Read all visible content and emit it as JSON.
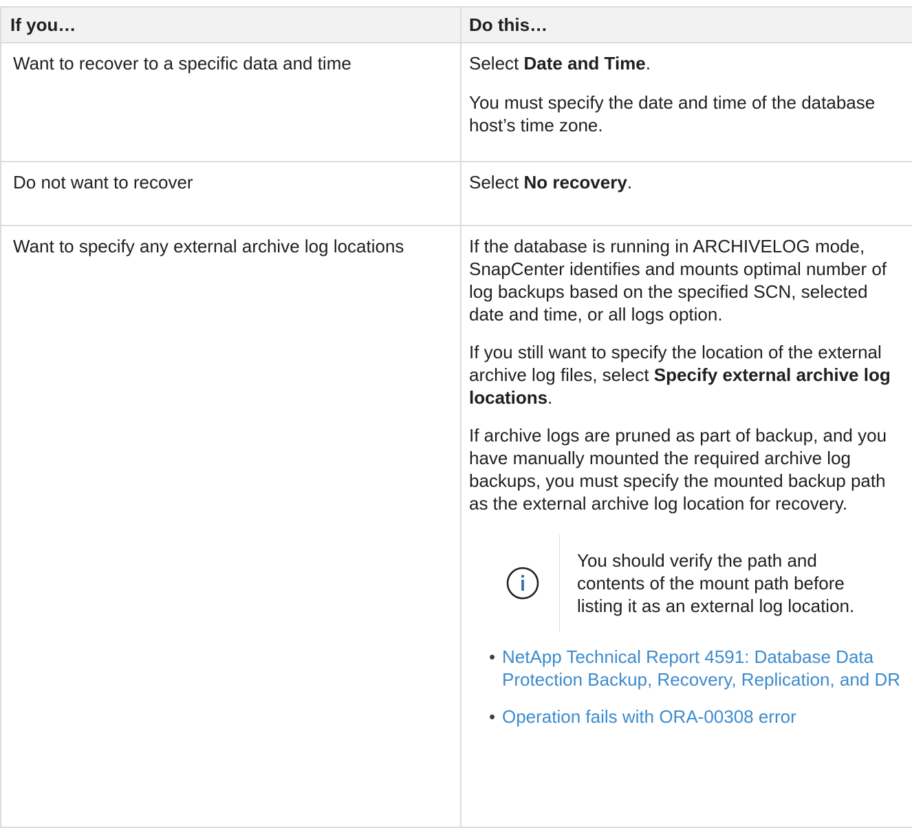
{
  "table": {
    "header": {
      "col1": "If you…",
      "col2": "Do this…"
    },
    "rows": [
      {
        "left": "Want to recover to a specific data and time",
        "right": {
          "p1_prefix": "Select ",
          "p1_bold": "Date and Time",
          "p1_suffix": ".",
          "p2": "You must specify the date and time of the database host’s time zone."
        }
      },
      {
        "left": "Do not want to recover",
        "right": {
          "p1_prefix": "Select ",
          "p1_bold": "No recovery",
          "p1_suffix": "."
        }
      },
      {
        "left": "Want to specify any external archive log locations",
        "right": {
          "p1": "If the database is running in ARCHIVELOG mode, SnapCenter identifies and mounts optimal number of log backups based on the specified SCN, selected date and time, or all logs option.",
          "p2_prefix": "If you still want to specify the location of the external archive log files, select ",
          "p2_bold": "Specify external archive log locations",
          "p2_suffix": ".",
          "p3": "If archive logs are pruned as part of backup, and you have manually mounted the required archive log backups, you must specify the mounted backup path as the external archive log location for recovery.",
          "note": "You should verify the path and contents of the mount path before listing it as an external log location.",
          "links": [
            "NetApp Technical Report 4591: Database Data Protection Backup, Recovery, Replication, and DR",
            "Operation fails with ORA-00308 error"
          ]
        }
      }
    ]
  },
  "colors": {
    "link": "#3d8bcd",
    "border": "#dcdcdc",
    "header_bg": "#f2f2f2",
    "info_icon": "#2d6cab"
  },
  "icons": {
    "note": "info-circle-icon"
  }
}
